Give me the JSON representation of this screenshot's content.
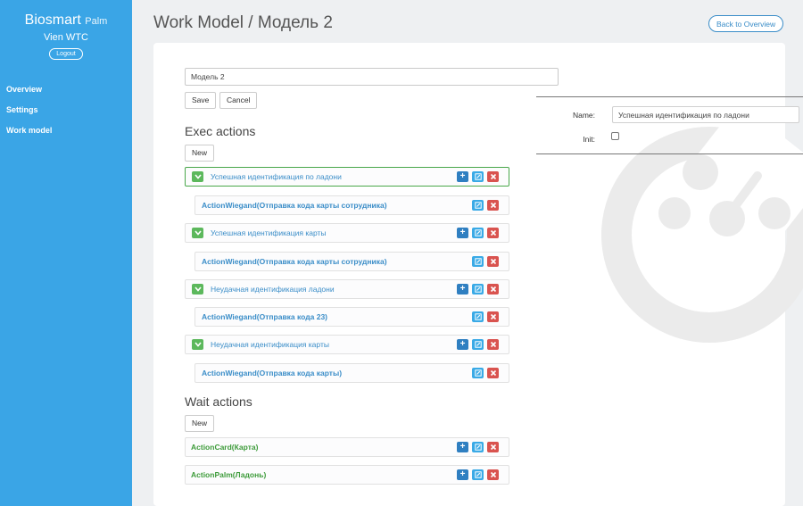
{
  "app": {
    "brand": "Biosmart",
    "brand_sub": "Palm",
    "site": "Vien WTC",
    "logout_label": "Logout"
  },
  "nav": {
    "items": [
      {
        "label": "Overview"
      },
      {
        "label": "Settings"
      },
      {
        "label": "Work model"
      }
    ]
  },
  "header": {
    "title": "Work Model / Модель 2",
    "back_label": "Back to Overview"
  },
  "model": {
    "name_value": "Модель 2",
    "save_label": "Save",
    "cancel_label": "Cancel"
  },
  "exec": {
    "title": "Exec actions",
    "new_label": "New",
    "groups": [
      {
        "label": "Успешная идентификация по ладони",
        "child": "ActionWiegand(Отправка кода карты сотрудника)"
      },
      {
        "label": "Успешная идентификация карты",
        "child": "ActionWiegand(Отправка кода карты сотрудника)"
      },
      {
        "label": "Неудачная идентификация ладони",
        "child": "ActionWiegand(Отправка кода 23)"
      },
      {
        "label": "Неудачная идентификация карты",
        "child": "ActionWiegand(Отправка кода карты)"
      }
    ]
  },
  "wait": {
    "title": "Wait actions",
    "new_label": "New",
    "items": [
      {
        "label": "ActionCard(Карта)"
      },
      {
        "label": "ActionPalm(Ладонь)"
      }
    ]
  },
  "properties": {
    "name_label": "Name:",
    "name_value": "Успешная идентификация по ладони",
    "init_label": "Init:",
    "init_checked": false
  },
  "colors": {
    "sidebar": "#3aa5e6",
    "add": "#2f7fc1",
    "edit": "#3aaae6",
    "delete": "#d9534f",
    "expand": "#5cb85c",
    "selected_border": "#49a74a"
  },
  "icons": {
    "expand": "chevron-down-icon",
    "add": "plus-icon",
    "edit": "edit-icon",
    "delete": "close-icon",
    "watermark": "biosmart-logo-icon"
  }
}
